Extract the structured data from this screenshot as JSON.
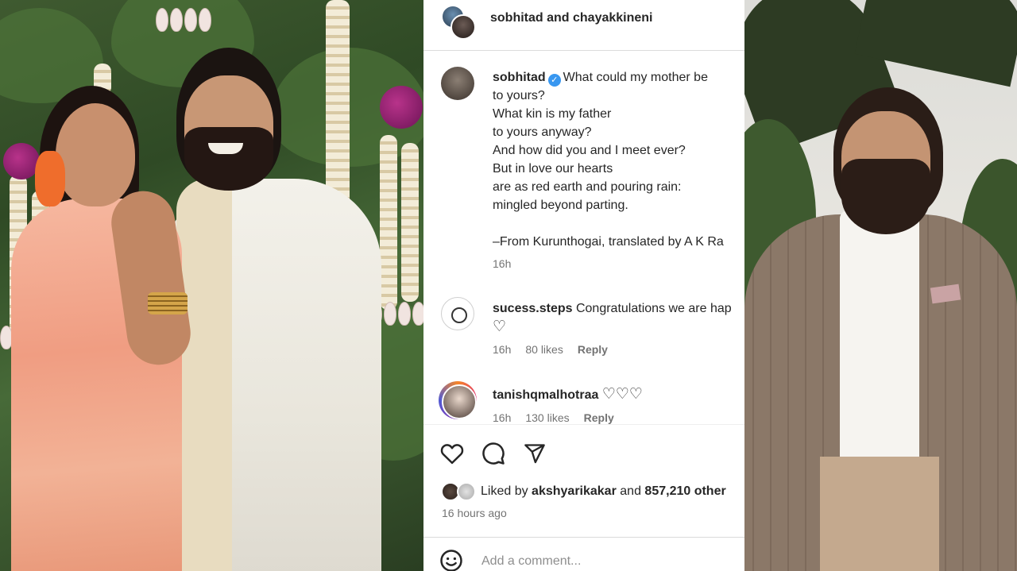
{
  "post": {
    "header_users": "sobhitad and chayakkineni",
    "caption": {
      "username": "sobhitad",
      "verified_glyph": "✓",
      "lines": [
        "What could my mother be",
        "to yours?",
        "What kin is my father",
        "to yours anyway?",
        "And how did you and I meet ever?",
        "But in love our hearts",
        "are as red earth and pouring rain:",
        "mingled beyond parting.",
        "",
        "–From Kurunthogai, translated by A K Ra"
      ],
      "time": "16h"
    },
    "comments": [
      {
        "username": "sucess.steps",
        "text": "Congratulations we are hap",
        "hearts": "♡",
        "time": "16h",
        "likes": "80 likes",
        "reply": "Reply"
      },
      {
        "username": "tanishqmalhotraa",
        "text": "",
        "hearts": "♡♡♡",
        "time": "16h",
        "likes": "130 likes",
        "reply": "Reply"
      }
    ],
    "likes": {
      "prefix": "Liked by",
      "user": "akshyarikakar",
      "middle": "and",
      "count": "857,210 other"
    },
    "post_time": "16 hours ago",
    "add_comment_placeholder": "Add a comment..."
  },
  "icons": {
    "like": "heart-icon",
    "comment": "comment-icon",
    "share": "share-icon",
    "emoji": "smiley-icon",
    "verified": "verified-badge-icon"
  },
  "colors": {
    "verified": "#3897f0",
    "text": "#262626",
    "muted": "#737373",
    "divider": "#dbdbdb"
  }
}
